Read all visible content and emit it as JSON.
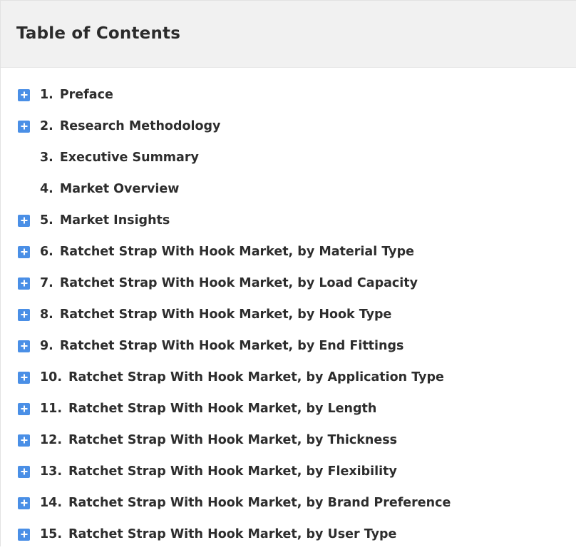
{
  "header": {
    "title": "Table of Contents"
  },
  "icons": {
    "expand": "plus-square-icon",
    "accent_color": "#4a8fe6"
  },
  "toc": {
    "items": [
      {
        "num": "1.",
        "label": "Preface",
        "expandable": true
      },
      {
        "num": "2.",
        "label": "Research Methodology",
        "expandable": true
      },
      {
        "num": "3.",
        "label": "Executive Summary",
        "expandable": false
      },
      {
        "num": "4.",
        "label": "Market Overview",
        "expandable": false
      },
      {
        "num": "5.",
        "label": "Market Insights",
        "expandable": true
      },
      {
        "num": "6.",
        "label": "Ratchet Strap With Hook Market, by Material Type",
        "expandable": true
      },
      {
        "num": "7.",
        "label": "Ratchet Strap With Hook Market, by Load Capacity",
        "expandable": true
      },
      {
        "num": "8.",
        "label": "Ratchet Strap With Hook Market, by Hook Type",
        "expandable": true
      },
      {
        "num": "9.",
        "label": "Ratchet Strap With Hook Market, by End Fittings",
        "expandable": true
      },
      {
        "num": "10.",
        "label": "Ratchet Strap With Hook Market, by Application Type",
        "expandable": true
      },
      {
        "num": "11.",
        "label": "Ratchet Strap With Hook Market, by Length",
        "expandable": true
      },
      {
        "num": "12.",
        "label": "Ratchet Strap With Hook Market, by Thickness",
        "expandable": true
      },
      {
        "num": "13.",
        "label": "Ratchet Strap With Hook Market, by Flexibility",
        "expandable": true
      },
      {
        "num": "14.",
        "label": "Ratchet Strap With Hook Market, by Brand Preference",
        "expandable": true
      },
      {
        "num": "15.",
        "label": "Ratchet Strap With Hook Market, by User Type",
        "expandable": true
      }
    ]
  }
}
